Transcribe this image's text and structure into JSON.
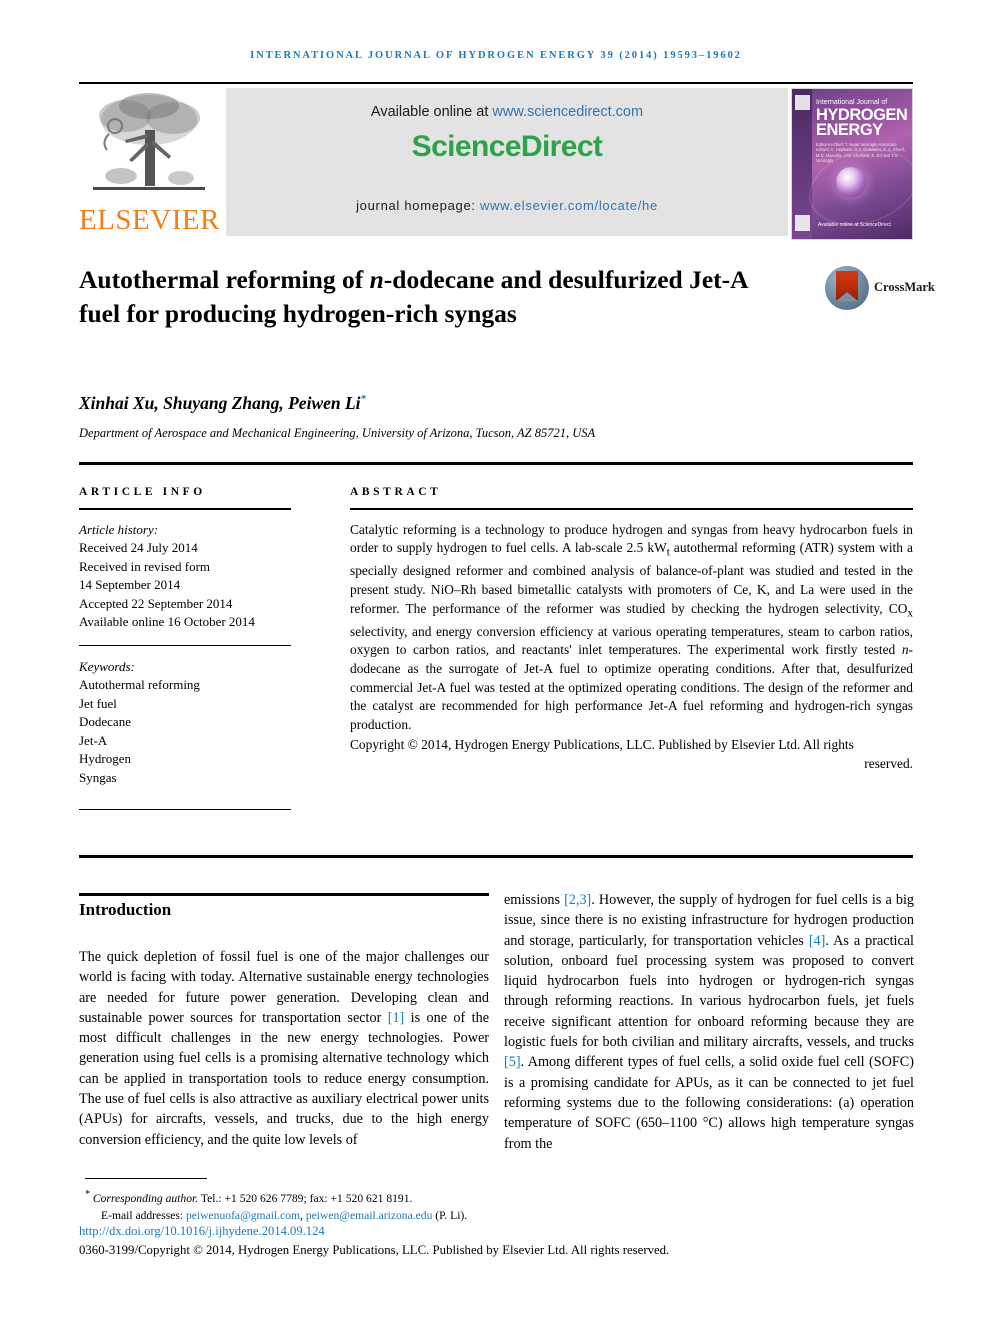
{
  "running_head": "INTERNATIONAL JOURNAL OF HYDROGEN ENERGY 39 (2014) 19593–19602",
  "masthead": {
    "publisher_word": "ELSEVIER",
    "available_prefix": "Available online at ",
    "available_url": "www.sciencedirect.com",
    "sciencedirect_logo": "ScienceDirect",
    "homepage_prefix": "journal homepage: ",
    "homepage_url": "www.elsevier.com/locate/he",
    "cover": {
      "small_title": "International Journal of",
      "big_title_line1": "HYDROGEN",
      "big_title_line2": "ENERGY",
      "editors": "Editor-in-Chief: T. Nejat Veziroglu   Associate editors: A. Hepbasli, D.Y. Goswami, S. A. Sherif, M.D. Mansilla, J.W. Sheffield, E. Ert and T.N. Veziroglu",
      "sciencedirect_mark": "Available online at ScienceDirect"
    }
  },
  "article": {
    "title_part1": "Autothermal reforming of ",
    "title_italic": "n",
    "title_part2": "-dodecane and desulfurized Jet-A fuel for producing hydrogen-rich syngas",
    "crossmark_label": "CrossMark",
    "authors": "Xinhai Xu, Shuyang Zhang, Peiwen Li",
    "author_marker": "*",
    "affiliation": "Department of Aerospace and Mechanical Engineering, University of Arizona, Tucson, AZ 85721, USA"
  },
  "article_info": {
    "heading": "ARTICLE INFO",
    "history_label": "Article history:",
    "history": [
      "Received 24 July 2014",
      "Received in revised form",
      "14 September 2014",
      "Accepted 22 September 2014",
      "Available online 16 October 2014"
    ],
    "keywords_label": "Keywords:",
    "keywords": [
      "Autothermal reforming",
      "Jet fuel",
      "Dodecane",
      "Jet-A",
      "Hydrogen",
      "Syngas"
    ]
  },
  "abstract": {
    "heading": "ABSTRACT",
    "text_1": "Catalytic reforming is a technology to produce hydrogen and syngas from heavy hydrocarbon fuels in order to supply hydrogen to fuel cells. A lab-scale 2.5 kW",
    "sub_1": "t",
    "text_2": " autothermal reforming (ATR) system with a specially designed reformer and combined analysis of balance-of-plant was studied and tested in the present study. NiO–Rh based bimetallic catalysts with promoters of Ce, K, and La were used in the reformer. The performance of the reformer was studied by checking the hydrogen selectivity, CO",
    "sub_2": "x",
    "text_3": " selectivity, and energy conversion efficiency at various operating temperatures, steam to carbon ratios, oxygen to carbon ratios, and reactants' inlet temperatures. The experimental work firstly tested ",
    "italic_1": "n",
    "text_4": "-dodecane as the surrogate of Jet-A fuel to optimize operating conditions. After that, desulfurized commercial Jet-A fuel was tested at the optimized operating conditions. The design of the reformer and the catalyst are recommended for high performance Jet-A fuel reforming and hydrogen-rich syngas production.",
    "copyright_main": "Copyright © 2014, Hydrogen Energy Publications, LLC. Published by Elsevier Ltd. All rights",
    "copyright_last": "reserved."
  },
  "body": {
    "section_title": "Introduction",
    "left_text_1": "The quick depletion of fossil fuel is one of the major challenges our world is facing with today. Alternative sustainable energy technologies are needed for future power generation. Developing clean and sustainable power sources for transportation sector ",
    "left_cite_1": "[1]",
    "left_text_2": " is one of the most difficult challenges in the new energy technologies. Power generation using fuel cells is a promising alternative technology which can be applied in transportation tools to reduce energy consumption. The use of fuel cells is also attractive as auxiliary electrical power units (APUs) for aircrafts, vessels, and trucks, due to the high energy conversion efficiency, and the quite low levels of",
    "right_text_1": "emissions ",
    "right_cite_1": "[2,3]",
    "right_text_2": ". However, the supply of hydrogen for fuel cells is a big issue, since there is no existing infrastructure for hydrogen production and storage, particularly, for transportation vehicles ",
    "right_cite_2": "[4]",
    "right_text_3": ". As a practical solution, onboard fuel processing system was proposed to convert liquid hydrocarbon fuels into hydrogen or hydrogen-rich syngas through reforming reactions. In various hydrocarbon fuels, jet fuels receive significant attention for onboard reforming because they are logistic fuels for both civilian and military aircrafts, vessels, and trucks ",
    "right_cite_3": "[5]",
    "right_text_4": ". Among different types of fuel cells, a solid oxide fuel cell (SOFC) is a promising candidate for APUs, as it can be connected to jet fuel reforming systems due to the following considerations: (a) operation temperature of SOFC (650–1100 °C) allows high temperature syngas from the"
  },
  "footer": {
    "corresponding_marker": "*",
    "corresponding_text": "Corresponding author.",
    "corresponding_contact": " Tel.: +1 520 626 7789; fax: +1 520 621 8191.",
    "email_label": "E-mail addresses: ",
    "email_1": "peiwenuofa@gmail.com",
    "email_sep": ", ",
    "email_2": "peiwen@email.arizona.edu",
    "email_suffix": " (P. Li).",
    "doi": "http://dx.doi.org/10.1016/j.ijhydene.2014.09.124",
    "issn_line": "0360-3199/Copyright © 2014, Hydrogen Energy Publications, LLC. Published by Elsevier Ltd. All rights reserved."
  }
}
